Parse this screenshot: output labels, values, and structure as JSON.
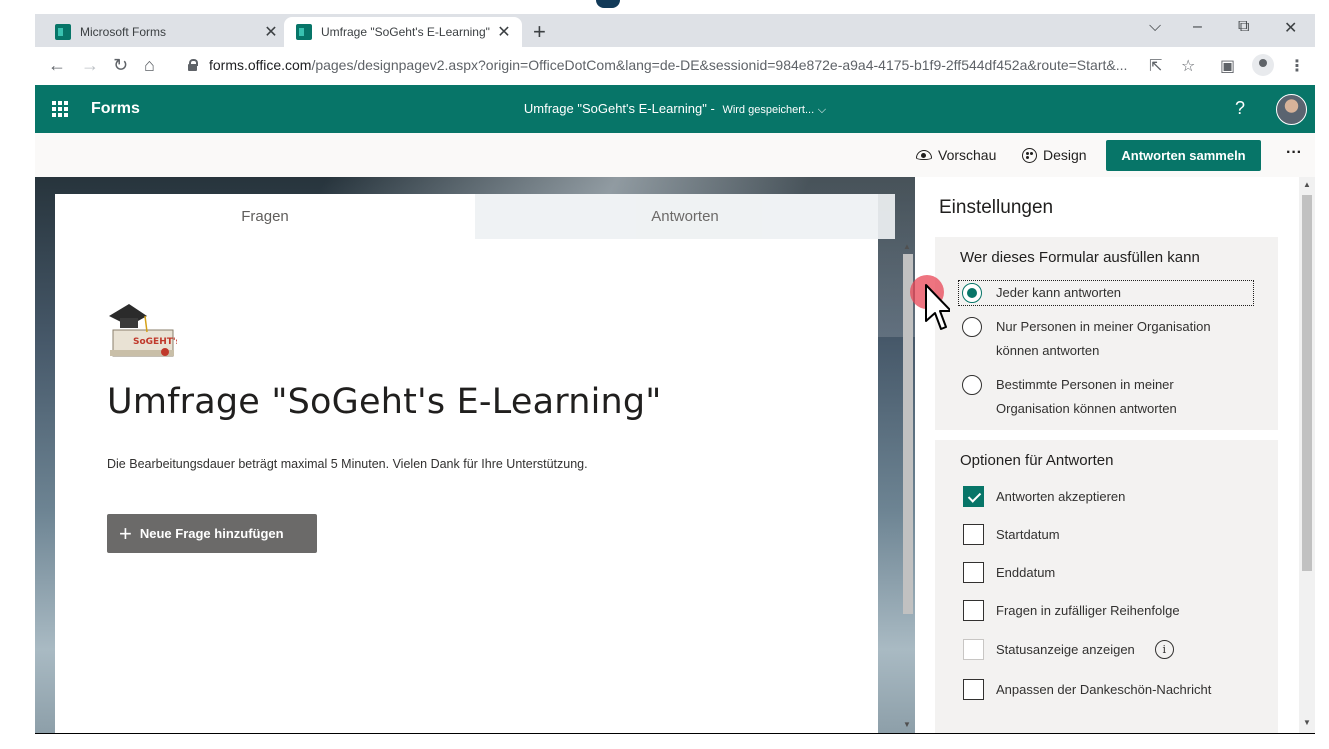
{
  "browser": {
    "tabs": [
      {
        "title": "Microsoft Forms",
        "active": false
      },
      {
        "title": "Umfrage \"SoGeht's E-Learning\"",
        "active": true
      }
    ],
    "new_tab": "+",
    "window_controls": {
      "collapse": "⌵",
      "minimize": "–",
      "restore": "⧉",
      "close": "✕"
    },
    "url_host": "forms.office.com",
    "url_path": "/pages/designpagev2.aspx?origin=OfficeDotCom&lang=de-DE&sessionid=984e872e-a9a4-4175-b1f9-2ff544df452a&route=Start&..."
  },
  "header": {
    "app_name": "Forms",
    "doc_title": "Umfrage \"SoGeht's E-Learning\"",
    "separator": "-",
    "save_status": "Wird gespeichert...",
    "help": "?"
  },
  "commands": {
    "preview": "Vorschau",
    "design": "Design",
    "collect": "Antworten sammeln",
    "more": "···"
  },
  "form": {
    "tabs": [
      "Fragen",
      "Antworten"
    ],
    "title": "Umfrage \"SoGeht's E-Learning\"",
    "description": "Die Bearbeitungsdauer beträgt maximal 5 Minuten. Vielen Dank für Ihre Unterstützung.",
    "add_question": "Neue Frage hinzufügen",
    "logo_text": "SoGEHT's!"
  },
  "settings": {
    "title": "Einstellungen",
    "who_title": "Wer dieses Formular ausfüllen kann",
    "who_options": [
      {
        "line1": "Jeder kann antworten",
        "line2": "",
        "checked": true
      },
      {
        "line1": "Nur Personen in meiner Organisation",
        "line2": "können antworten",
        "checked": false
      },
      {
        "line1": "Bestimmte Personen in meiner",
        "line2": "Organisation können antworten",
        "checked": false
      }
    ],
    "options_title": "Optionen für Antworten",
    "options": [
      {
        "label": "Antworten akzeptieren",
        "checked": true,
        "disabled": false
      },
      {
        "label": "Startdatum",
        "checked": false,
        "disabled": false
      },
      {
        "label": "Enddatum",
        "checked": false,
        "disabled": false
      },
      {
        "label": "Fragen in zufälliger Reihenfolge",
        "checked": false,
        "disabled": false
      },
      {
        "label": "Statusanzeige anzeigen",
        "checked": false,
        "disabled": true
      },
      {
        "label": "Anpassen der Dankeschön-Nachricht",
        "checked": false,
        "disabled": false
      }
    ],
    "info": "i"
  },
  "colors": {
    "brand": "#077568",
    "button_gray": "#6b6a69",
    "click_highlight": "#e84656"
  }
}
